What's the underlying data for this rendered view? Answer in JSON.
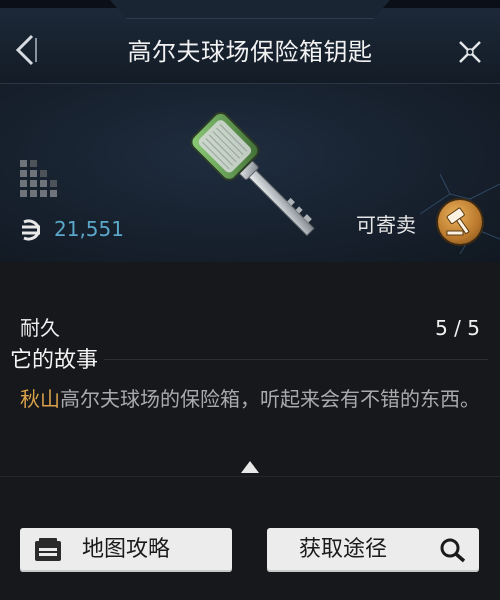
{
  "header": {
    "title": "高尔夫球场保险箱钥匙"
  },
  "item": {
    "price": "21,551",
    "tradeable_label": "可寄卖",
    "icons": {
      "grid": "rarity-grid-icon",
      "currency": "currency-icon",
      "auction": "auction-hammer-icon",
      "art": "safe-key-icon"
    }
  },
  "details": {
    "durability_label": "耐久",
    "durability_value": "5 / 5",
    "story_title": "它的故事",
    "story_highlight": "秋山",
    "story_text": "高尔夫球场的保险箱，听起来会有不错的东西。"
  },
  "buttons": {
    "map_label": "地图攻略",
    "source_label": "获取途径"
  },
  "colors": {
    "price": "#5ba7c9",
    "highlight": "#d9a24a",
    "button_bg": "#ececec"
  }
}
